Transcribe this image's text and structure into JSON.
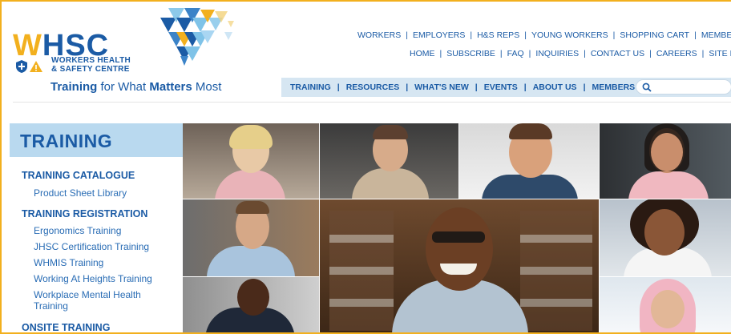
{
  "logo": {
    "letters_w": "W",
    "letters_rest": "HSC",
    "sub_line1": "WORKERS HEALTH",
    "sub_line2": "& SAFETY CENTRE",
    "colors": {
      "blue": "#1b5ba5",
      "yellow": "#f2b01e",
      "sky": "#7fc3e8"
    }
  },
  "tagline": {
    "part1": "Training",
    "part2": " for What ",
    "part3": "Matters",
    "part4": " Most"
  },
  "top_nav_1": [
    "WORKERS",
    "EMPLOYERS",
    "H&S REPS",
    "YOUNG WORKERS",
    "SHOPPING CART",
    "MEMBERS LOGIN"
  ],
  "top_nav_2": [
    "HOME",
    "SUBSCRIBE",
    "FAQ",
    "INQUIRIES",
    "CONTACT US",
    "CAREERS",
    "SITE MA"
  ],
  "main_nav": [
    "TRAINING",
    "RESOURCES",
    "WHAT'S NEW",
    "EVENTS",
    "ABOUT US",
    "MEMBERS"
  ],
  "separator": "|",
  "search": {
    "placeholder": "",
    "icon": "search-icon"
  },
  "sidebar": {
    "title": "TRAINING",
    "sections": [
      {
        "label": "TRAINING CATALOGUE",
        "items": [
          "Product Sheet Library"
        ]
      },
      {
        "label": "TRAINING REGISTRATION",
        "items": [
          "Ergonomics Training",
          "JHSC Certification Training",
          "WHMIS Training",
          "Working At Heights Training",
          "Workplace Mental Health Training"
        ]
      },
      {
        "label": "ONSITE TRAINING",
        "items": []
      }
    ]
  },
  "collage": {
    "description_tiles": 10
  }
}
